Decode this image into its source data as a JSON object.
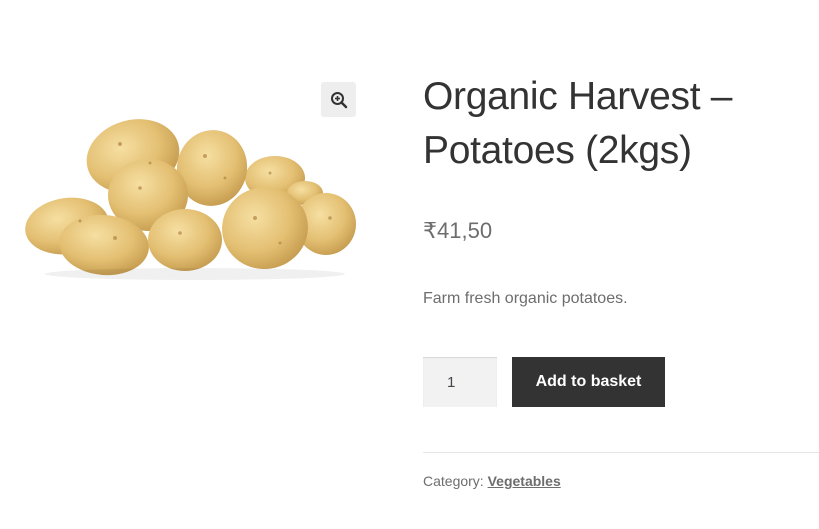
{
  "product": {
    "title": "Organic Harvest – Potatoes (2kgs)",
    "price": "₹41,50",
    "description": "Farm fresh organic potatoes.",
    "quantity_value": "1",
    "add_button_label": "Add to basket",
    "category_label": "Category:",
    "category_value": "Vegetables"
  },
  "gallery": {
    "image_name": "potatoes-image",
    "zoom_icon": "zoom-in-icon"
  }
}
